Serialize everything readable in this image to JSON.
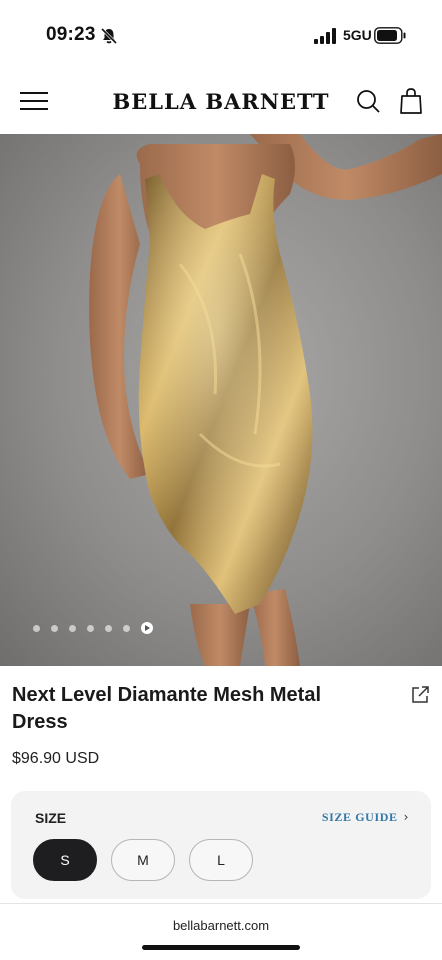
{
  "status_bar": {
    "time": "09:23",
    "network": "5GU",
    "icons": [
      "bell-muted-icon",
      "signal-icon",
      "battery-icon"
    ]
  },
  "header": {
    "brand": "BELLA BARNETT",
    "icons": [
      "menu-icon",
      "search-icon",
      "bag-icon"
    ]
  },
  "gallery": {
    "image_dots": 6,
    "has_video": true
  },
  "product": {
    "title": "Next Level Diamante Mesh Metal Dress",
    "price": "$96.90 USD"
  },
  "size": {
    "label": "SIZE",
    "guide_label": "SIZE GUIDE",
    "options": [
      "S",
      "M",
      "L"
    ],
    "selected": "S"
  },
  "browser": {
    "url": "bellabarnett.com"
  },
  "colors": {
    "accent_link": "#3378a8",
    "selected_size_bg": "#1e1e20",
    "panel_bg": "#f3f3f3"
  }
}
